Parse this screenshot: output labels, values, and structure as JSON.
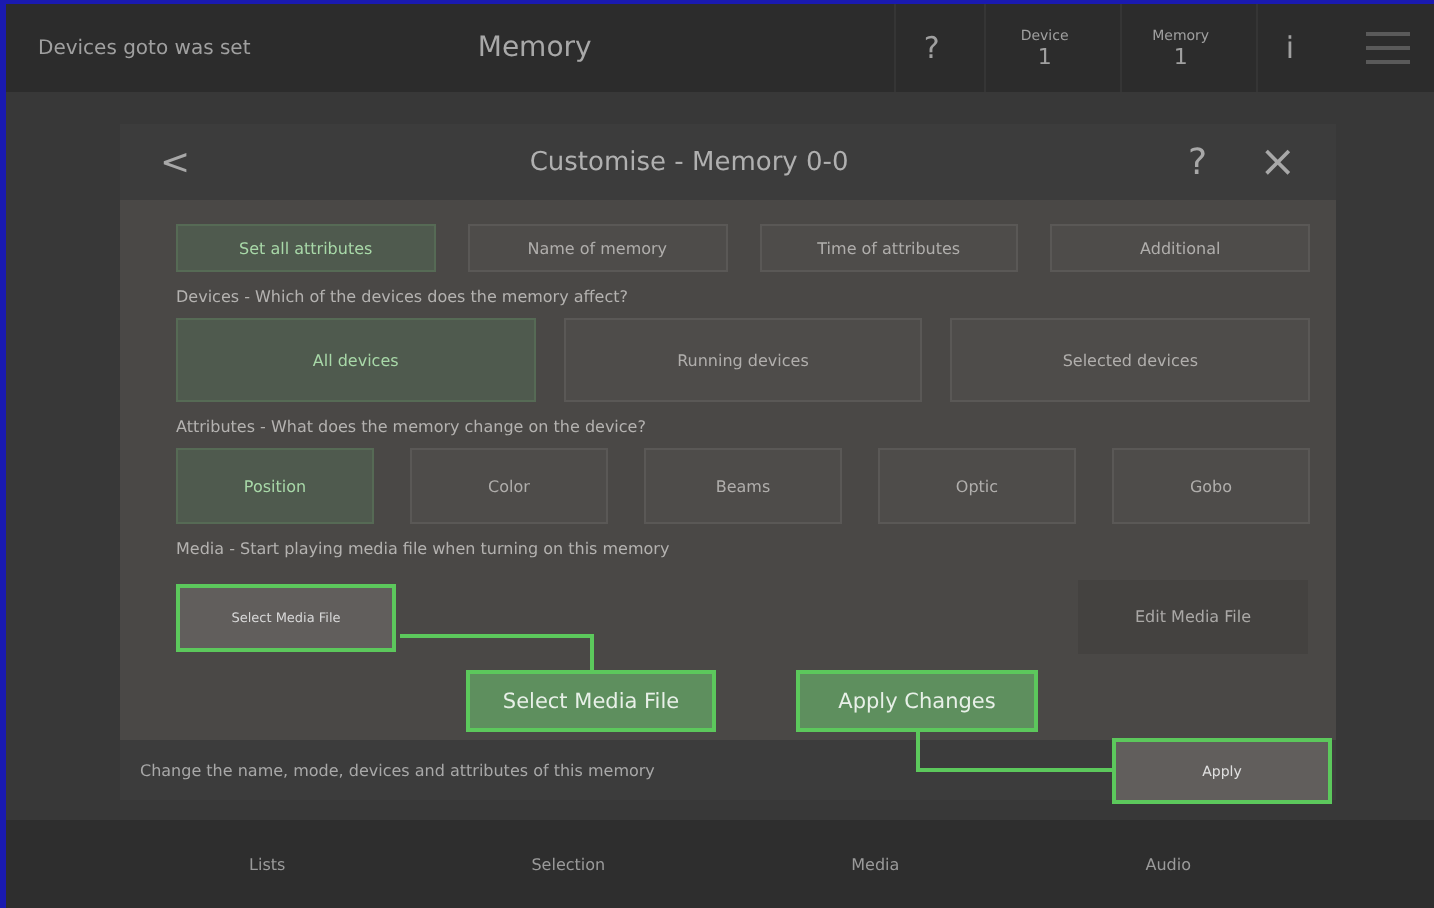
{
  "top_bar": {
    "status": "Devices goto was set",
    "title": "Memory",
    "help": "?",
    "counters": [
      {
        "label": "Device",
        "value": "1"
      },
      {
        "label": "Memory",
        "value": "1"
      }
    ],
    "info": "i"
  },
  "dialog": {
    "back": "<",
    "title": "Customise - Memory 0-0",
    "help": "?",
    "close": "×",
    "modes": [
      {
        "label": "Set all attributes",
        "selected": true
      },
      {
        "label": "Name of memory",
        "selected": false
      },
      {
        "label": "Time of attributes",
        "selected": false
      },
      {
        "label": "Additional",
        "selected": false
      }
    ],
    "devices": {
      "label": "Devices - Which of the devices does the memory affect?",
      "options": [
        {
          "label": "All devices",
          "selected": true
        },
        {
          "label": "Running devices",
          "selected": false
        },
        {
          "label": "Selected devices",
          "selected": false
        }
      ]
    },
    "attributes": {
      "label": "Attributes - What does the memory change on the device?",
      "options": [
        {
          "label": "Position",
          "selected": true
        },
        {
          "label": "Color",
          "selected": false
        },
        {
          "label": "Beams",
          "selected": false
        },
        {
          "label": "Optic",
          "selected": false
        },
        {
          "label": "Gobo",
          "selected": false
        }
      ]
    },
    "media": {
      "label": "Media - Start playing media file when turning on this memory",
      "select_button": "Select Media File",
      "edit_button": "Edit Media File"
    },
    "footer": "Change the name, mode, devices and attributes of this memory",
    "apply_button": "Apply"
  },
  "callouts": [
    "Select Media File",
    "Apply Changes"
  ],
  "bottom_tabs": [
    "Lists",
    "Selection",
    "Media",
    "Audio"
  ]
}
